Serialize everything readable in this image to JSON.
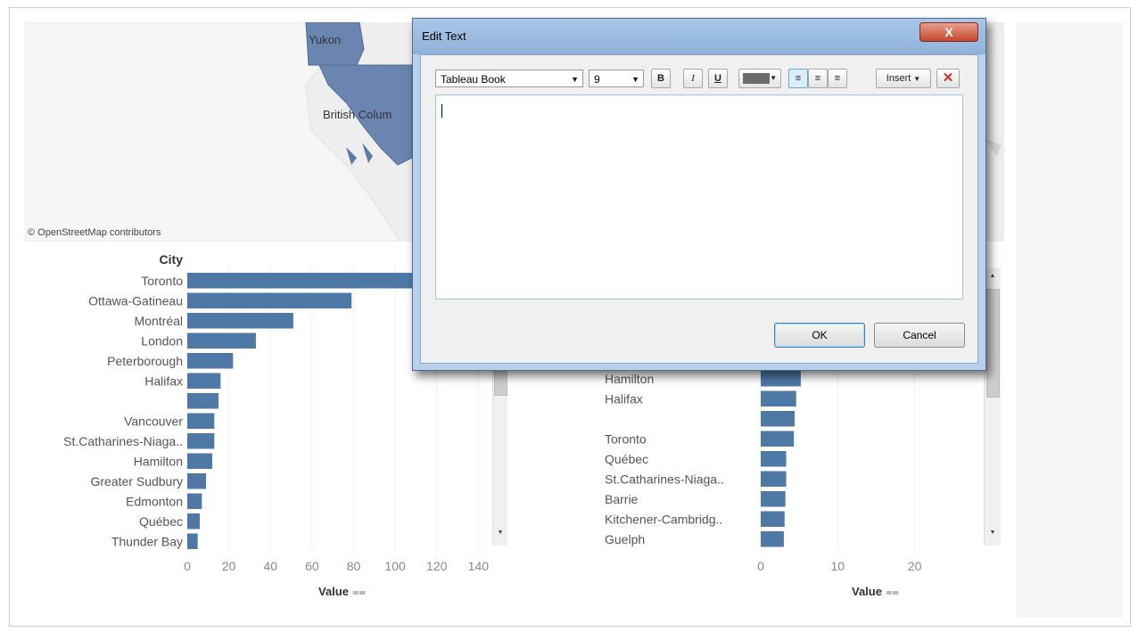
{
  "map": {
    "labels": [
      "Yukon",
      "British Colum"
    ],
    "attribution": "© OpenStreetMap contributors",
    "region_color": "#6a86b0"
  },
  "accent_bar_color": "#4e79a7",
  "chart_data": [
    {
      "type": "bar",
      "orientation": "horizontal",
      "category_header": "City",
      "xlabel": "Value",
      "xlim": [
        0,
        145
      ],
      "xticks": [
        0,
        20,
        40,
        60,
        80,
        100,
        120,
        140
      ],
      "categories": [
        "Toronto",
        "Ottawa-Gatineau",
        "Montréal",
        "London",
        "Peterborough",
        "Halifax",
        "",
        "Vancouver",
        "St.Catharines-Niaga..",
        "Hamilton",
        "Greater Sudbury",
        "Edmonton",
        "Québec",
        "Thunder Bay"
      ],
      "values": [
        140,
        79,
        51,
        33,
        22,
        16,
        15,
        13,
        13,
        12,
        9,
        7,
        6,
        5
      ]
    },
    {
      "type": "bar",
      "orientation": "horizontal",
      "xlabel": "Value",
      "xlim": [
        0,
        27
      ],
      "xticks": [
        0,
        10,
        20
      ],
      "categories": [
        "Hamilton",
        "Halifax",
        "",
        "Toronto",
        "Québec",
        "St.Catharines-Niaga..",
        "Barrie",
        "Kitchener-Cambridg..",
        "Guelph"
      ],
      "values": [
        5.2,
        4.6,
        4.4,
        4.3,
        3.3,
        3.3,
        3.2,
        3.1,
        3.0
      ]
    }
  ],
  "dialog": {
    "title": "Edit Text",
    "close_label": "X",
    "font_name": "Tableau Book",
    "font_size": "9",
    "bold_label": "B",
    "italic_label": "I",
    "underline_label": "U",
    "insert_label": "Insert",
    "clear_label": "✕",
    "ok_label": "OK",
    "cancel_label": "Cancel"
  }
}
